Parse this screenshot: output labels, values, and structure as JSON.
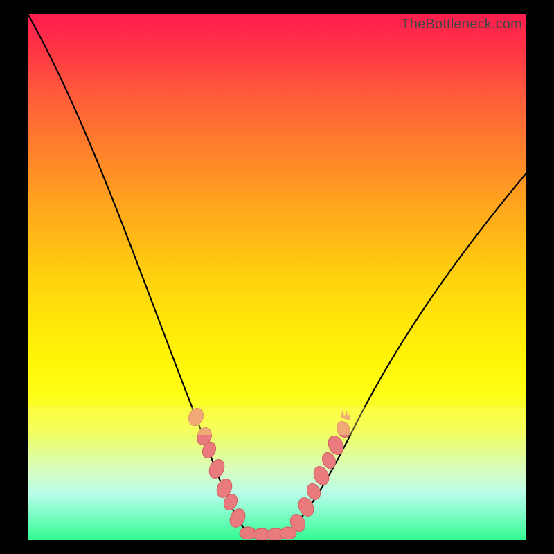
{
  "watermark": "TheBottleneck.com",
  "chart_data": {
    "type": "line",
    "title": "",
    "xlabel": "",
    "ylabel": "",
    "xlim": [
      0,
      100
    ],
    "ylim": [
      0,
      100
    ],
    "series": [
      {
        "name": "bottleneck-curve",
        "x": [
          0,
          5,
          10,
          15,
          20,
          25,
          30,
          35,
          40,
          42,
          45,
          48,
          50,
          53,
          57,
          62,
          68,
          75,
          82,
          90,
          100
        ],
        "values": [
          100,
          87,
          73,
          59,
          46,
          34,
          23,
          14,
          6,
          3,
          0,
          0,
          0,
          2,
          7,
          14,
          23,
          33,
          44,
          56,
          72
        ]
      }
    ],
    "markers": [
      {
        "name": "left-cluster",
        "x_range": [
          33,
          41
        ],
        "approx_values": [
          18,
          15,
          12,
          10,
          7,
          5,
          3
        ]
      },
      {
        "name": "bottom-run",
        "x_range": [
          42,
          52
        ],
        "approx_values": [
          1,
          0,
          0,
          0,
          0,
          1
        ]
      },
      {
        "name": "right-cluster",
        "x_range": [
          53,
          61
        ],
        "approx_values": [
          3,
          5,
          7,
          10,
          12,
          15
        ]
      }
    ],
    "gradient_scale": {
      "100": "red",
      "50": "yellow",
      "0": "green"
    }
  },
  "colors": {
    "curve": "#000000",
    "marker_fill": "#e97b7e",
    "marker_stroke": "#d05d60"
  }
}
